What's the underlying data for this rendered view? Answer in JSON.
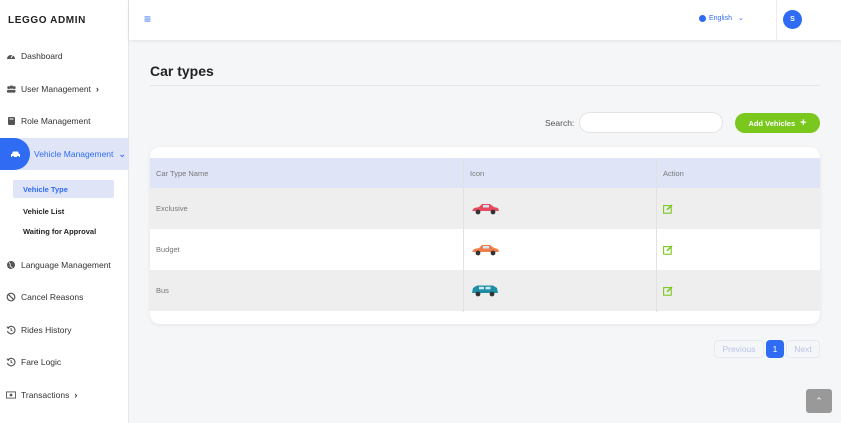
{
  "brand": "LEGGO ADMIN",
  "sidebar": {
    "items": [
      {
        "label": "Dashboard",
        "icon": "dashboard-icon"
      },
      {
        "label": "User Management",
        "icon": "users-icon"
      },
      {
        "label": "Role Management",
        "icon": "book-icon"
      },
      {
        "label": "Vehicle Management",
        "icon": "car-icon"
      },
      {
        "label": "Language Management",
        "icon": "globe-icon"
      },
      {
        "label": "Cancel Reasons",
        "icon": "ban-icon"
      },
      {
        "label": "Rides History",
        "icon": "history-icon"
      },
      {
        "label": "Fare Logic",
        "icon": "history-icon"
      },
      {
        "label": "Transactions",
        "icon": "money-icon"
      }
    ],
    "submenu": [
      {
        "label": "Vehicle Type"
      },
      {
        "label": "Vehicle List"
      },
      {
        "label": "Waiting for Approval"
      }
    ]
  },
  "header": {
    "language": "English",
    "avatar_initial": "S"
  },
  "main": {
    "title": "Car types",
    "search_label": "Search:",
    "add_button": "Add Vehicles",
    "table": {
      "columns": [
        "Car Type Name",
        "Icon",
        "Action"
      ],
      "rows": [
        {
          "name": "Exclusive",
          "icon_color": "#e84a5f"
        },
        {
          "name": "Budget",
          "icon_color": "#f07e4a"
        },
        {
          "name": "Bus",
          "icon_color": "#1c8fa6"
        }
      ]
    },
    "pagination": {
      "previous": "Previous",
      "current": "1",
      "next": "Next"
    }
  },
  "colors": {
    "accent": "#2f6bf3",
    "success": "#7ac81e",
    "edit_icon": "#7ac81e"
  }
}
